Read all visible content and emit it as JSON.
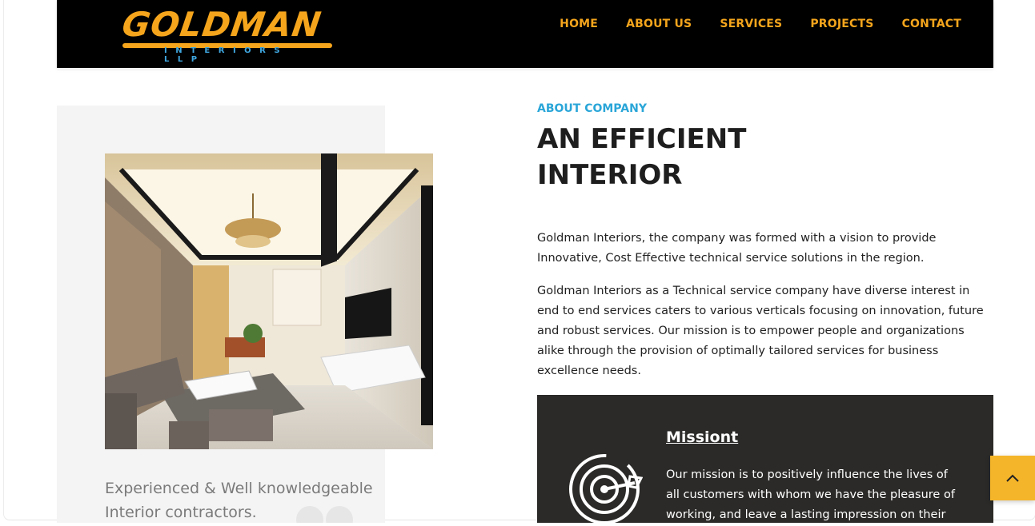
{
  "brand": {
    "name": "GOLDMAN",
    "subtitle": "INTERIORS LLP",
    "primary_color": "#f5a51c",
    "secondary_color": "#3fa7e0"
  },
  "nav": {
    "items": [
      {
        "label": "HOME"
      },
      {
        "label": "ABOUT US"
      },
      {
        "label": "SERVICES"
      },
      {
        "label": "PROJECTS"
      },
      {
        "label": "CONTACT"
      }
    ]
  },
  "about": {
    "eyebrow": "ABOUT COMPANY",
    "headline_line1": "AN EFFICIENT",
    "headline_line2": "INTERIOR",
    "paragraph1": "Goldman Interiors, the company was formed with a vision to provide Innovative, Cost Effective technical service solutions in the region.",
    "paragraph2": "Goldman Interiors as a Technical service company have diverse interest in end to end services caters to various verticals focusing on innovation, future and robust services. Our mission is to empower people and organizations alike through the provision of optimally tailored services for business excellence needs."
  },
  "left": {
    "tagline": "Experienced & Well knowledgeable Interior contractors."
  },
  "mission": {
    "title": "Missiont",
    "text": "Our mission is to positively influence the lives of all customers with whom we have the pleasure of working, and leave a lasting impression on their",
    "icon": "target-icon"
  },
  "scroll_top": {
    "icon": "chevron-up-icon",
    "color": "#f5b52a"
  }
}
